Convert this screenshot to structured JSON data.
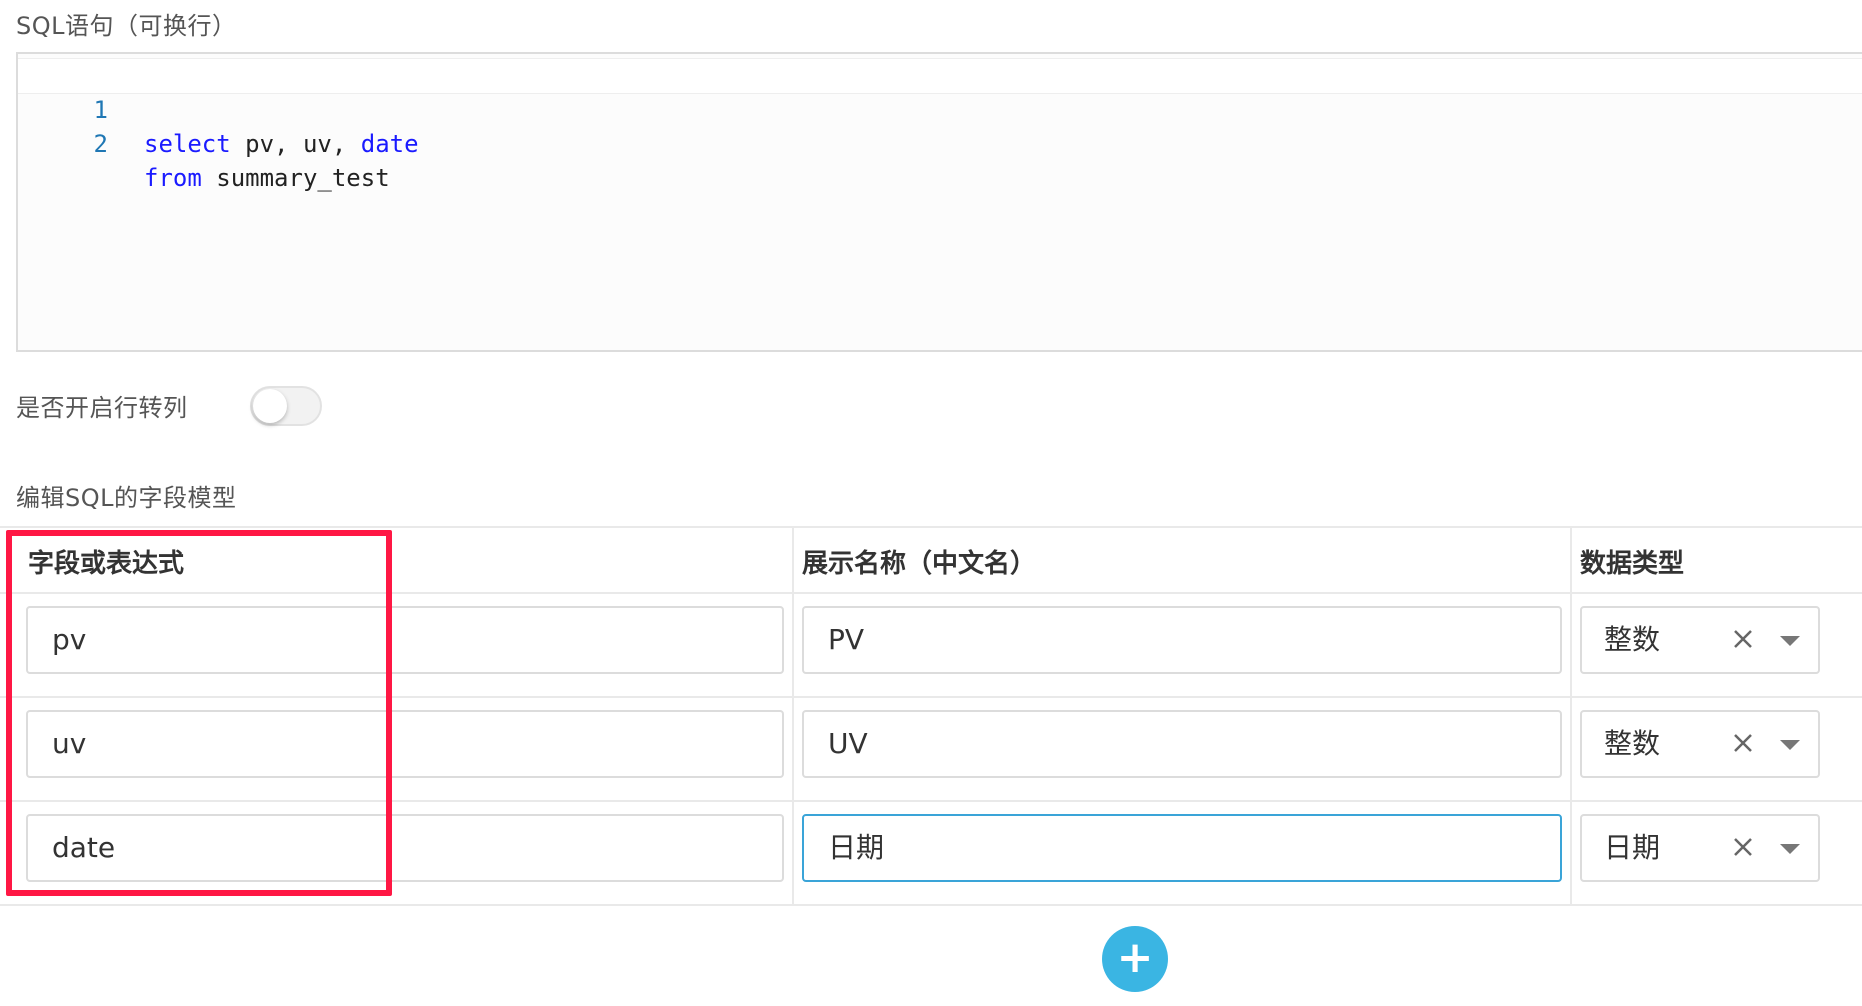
{
  "sql_section": {
    "label": "SQL语句（可换行）",
    "lines": [
      {
        "number": "1",
        "keyword": "select",
        "rest": " pv, uv, ",
        "keyword2": "date"
      },
      {
        "number": "2",
        "keyword": "from",
        "rest": " summary_test"
      }
    ]
  },
  "toggle": {
    "label": "是否开启行转列",
    "state": "off"
  },
  "field_model": {
    "label": "编辑SQL的字段模型",
    "columns": [
      "字段或表达式",
      "展示名称（中文名）",
      "数据类型"
    ],
    "rows": [
      {
        "field": "pv",
        "display_name": "PV",
        "data_type": "整数"
      },
      {
        "field": "uv",
        "display_name": "UV",
        "data_type": "整数"
      },
      {
        "field": "date",
        "display_name": "日期",
        "data_type": "日期"
      }
    ],
    "add_label": "+"
  },
  "colors": {
    "highlight": "#ff1744",
    "accent": "#3ab5e3",
    "keyword": "#1a1aff",
    "focus_border": "#3aa4d8"
  },
  "icons": {
    "clear": "close-icon",
    "dropdown": "caret-down-icon",
    "add": "plus-icon"
  }
}
